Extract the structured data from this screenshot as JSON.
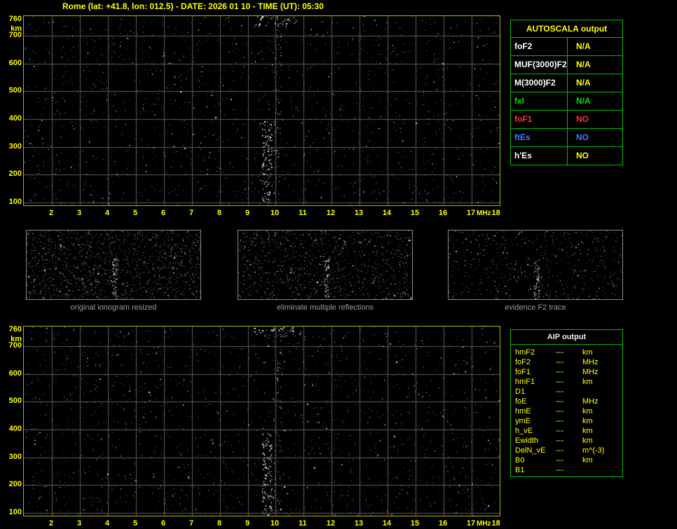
{
  "header": {
    "title": "Rome (lat: +41.8, lon: 012.5) - DATE: 2026 01 10 - TIME (UT): 05:30"
  },
  "ionogram": {
    "y_unit": "km",
    "x_unit": "MHz",
    "y_ticks": [
      "760",
      "700",
      "600",
      "500",
      "400",
      "300",
      "200",
      "100"
    ],
    "x_ticks": [
      "2",
      "3",
      "4",
      "5",
      "6",
      "7",
      "8",
      "9",
      "10",
      "11",
      "12",
      "13",
      "14",
      "15",
      "16",
      "17",
      "18"
    ]
  },
  "chart_data": [
    {
      "type": "scatter",
      "title": "raw ionogram (top panel)",
      "xlabel": "MHz",
      "ylabel": "km",
      "xlim": [
        1,
        18
      ],
      "ylim": [
        90,
        770
      ],
      "x_ticks": [
        2,
        3,
        4,
        5,
        6,
        7,
        8,
        9,
        10,
        11,
        12,
        13,
        14,
        15,
        16,
        17,
        18
      ],
      "y_ticks": [
        100,
        200,
        300,
        400,
        500,
        600,
        700,
        760
      ],
      "grid": true,
      "series": [],
      "content": "background noise speckle only; no scaled echo traces (all AUTOSCALA outputs N/A)"
    },
    {
      "type": "scatter",
      "title": "processed ionogram (bottom panel)",
      "xlabel": "MHz",
      "ylabel": "km",
      "xlim": [
        1,
        18
      ],
      "ylim": [
        90,
        770
      ],
      "x_ticks": [
        2,
        3,
        4,
        5,
        6,
        7,
        8,
        9,
        10,
        11,
        12,
        13,
        14,
        15,
        16,
        17,
        18
      ],
      "y_ticks": [
        100,
        200,
        300,
        400,
        500,
        600,
        700,
        760
      ],
      "grid": true,
      "series": [],
      "content": "background noise speckle only; no scaled echo traces (all AIP outputs ---)"
    }
  ],
  "autoscala_table": {
    "title": "AUTOSCALA output",
    "rows": [
      {
        "label": "foF2",
        "value": "N/A",
        "label_color": "#ffffff",
        "value_color": "#ffff00"
      },
      {
        "label": "MUF(3000)F2",
        "value": "N/A",
        "label_color": "#ffffff",
        "value_color": "#ffff00"
      },
      {
        "label": "M(3000)F2",
        "value": "N/A",
        "label_color": "#ffffff",
        "value_color": "#ffff00"
      },
      {
        "label": "fxI",
        "value": "N/A",
        "label_color": "#00dd00",
        "value_color": "#00dd00"
      },
      {
        "label": "foF1",
        "value": "NO",
        "label_color": "#ff2a2a",
        "value_color": "#ff2a2a"
      },
      {
        "label": "ftEs",
        "value": "NO",
        "label_color": "#3b7bff",
        "value_color": "#3b7bff"
      },
      {
        "label": "h'Es",
        "value": "NO",
        "label_color": "#ffffff",
        "value_color": "#ffff00"
      }
    ]
  },
  "thumbnails": [
    {
      "caption": "original ionogram resized"
    },
    {
      "caption": "eliminate multiple reflections"
    },
    {
      "caption": "evidence F2 trace"
    }
  ],
  "aip_table": {
    "title": "AIP output",
    "rows": [
      {
        "name": "hmF2",
        "value": "---",
        "unit": "km"
      },
      {
        "name": "foF2",
        "value": "---",
        "unit": "MHz"
      },
      {
        "name": "foF1",
        "value": "---",
        "unit": "MHz"
      },
      {
        "name": "hmF1",
        "value": "---",
        "unit": "km"
      },
      {
        "name": "D1",
        "value": "---",
        "unit": ""
      },
      {
        "name": "foE",
        "value": "---",
        "unit": "MHz"
      },
      {
        "name": "hmE",
        "value": "---",
        "unit": "km"
      },
      {
        "name": "ymE",
        "value": "---",
        "unit": "km"
      },
      {
        "name": "h_vE",
        "value": "---",
        "unit": "km"
      },
      {
        "name": "Ewidth",
        "value": "---",
        "unit": "km"
      },
      {
        "name": "DelN_vE",
        "value": "---",
        "unit": "m^(-3)"
      },
      {
        "name": "B0",
        "value": "---",
        "unit": "km"
      },
      {
        "name": "B1",
        "value": "---",
        "unit": ""
      }
    ]
  },
  "colors": {
    "title": "#ffff00",
    "plot_border": "#b5b500",
    "grid": "#5c5c5c",
    "table_border": "#00bb00",
    "caption": "#9a9a9a",
    "background": "#000000"
  }
}
